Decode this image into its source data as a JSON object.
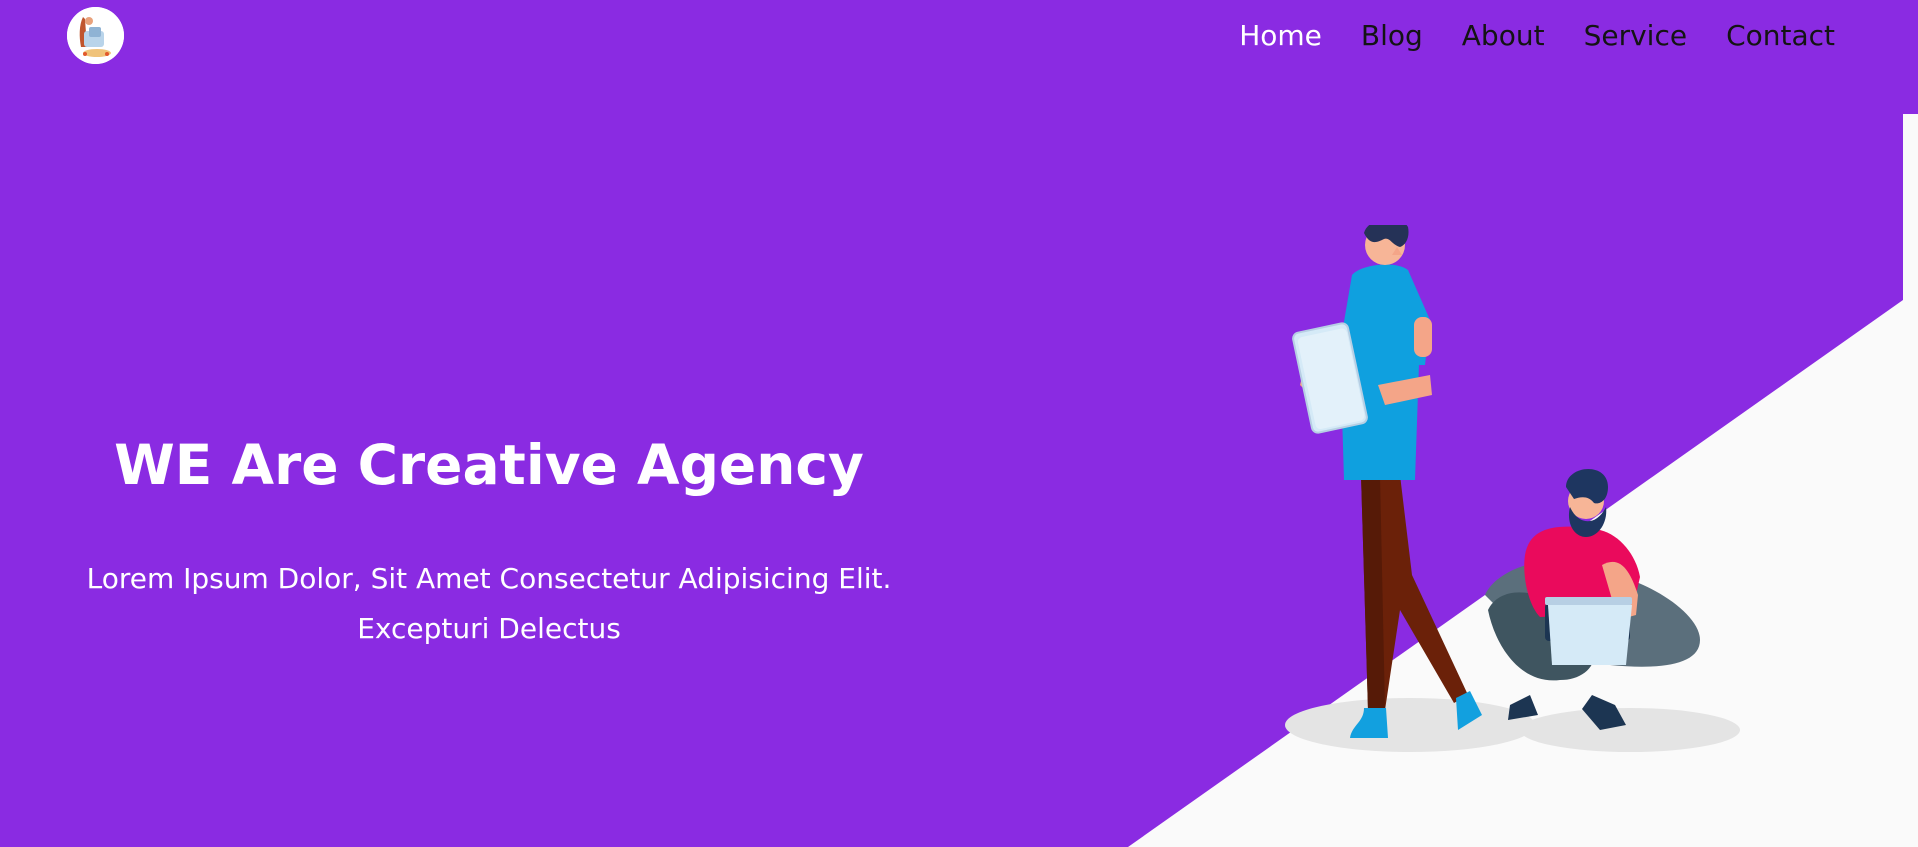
{
  "theme": {
    "primary": "#8a2be2",
    "surface": "#fafafa",
    "nav_text": "#141414",
    "nav_active": "#ffffff"
  },
  "header": {
    "logo_icon": "laptop-worker-logo-icon",
    "nav": [
      {
        "label": "Home",
        "active": true
      },
      {
        "label": "Blog",
        "active": false
      },
      {
        "label": "About",
        "active": false
      },
      {
        "label": "Service",
        "active": false
      },
      {
        "label": "Contact",
        "active": false
      }
    ]
  },
  "hero": {
    "title": "WE Are Creative Agency",
    "text_line1": "Lorem Ipsum Dolor, Sit Amet Consectetur Adipisicing Elit.",
    "text_line2": "Excepturi Delectus",
    "illustration_icon": "people-with-devices-illustration"
  }
}
